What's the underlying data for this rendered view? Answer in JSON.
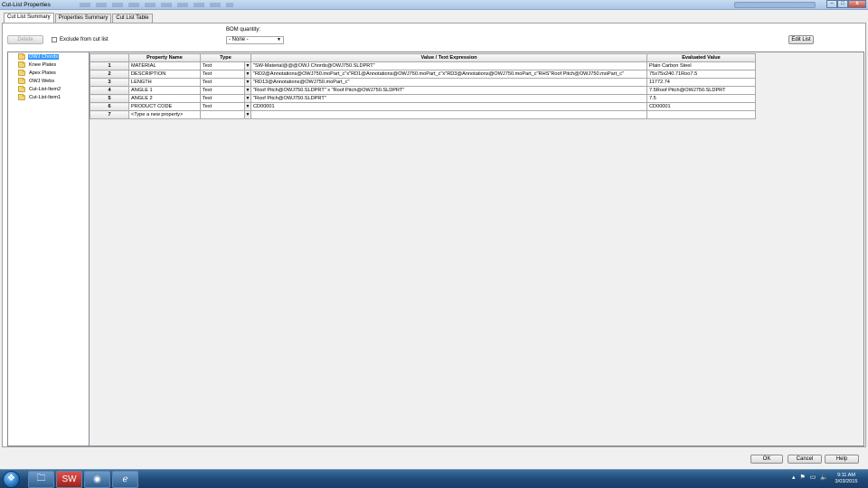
{
  "window": {
    "title": "Cut-List Properties",
    "close": "x",
    "maximize": "□",
    "minimize": "–"
  },
  "tabs": [
    {
      "label": "Cut List Summary",
      "active": true
    },
    {
      "label": "Properties Summary",
      "active": false
    },
    {
      "label": "Cut List Table",
      "active": false
    }
  ],
  "toolbar": {
    "delete_label": "Delete",
    "exclude_label": "Exclude from cut list",
    "bom_label": "BOM quantity:",
    "bom_value": "- None -",
    "edit_list_label": "Edit List"
  },
  "tree": {
    "items": [
      {
        "label": "OWJ Chords",
        "selected": true
      },
      {
        "label": "Knee Plates"
      },
      {
        "label": "Apex Plates"
      },
      {
        "label": "OWJ Webs"
      },
      {
        "label": "Cut-List-Item2"
      },
      {
        "label": "Cut-List-Item1"
      }
    ]
  },
  "grid": {
    "headers": [
      "",
      "Property Name",
      "Type",
      "Value / Text Expression",
      "Evaluated Value"
    ],
    "rows": [
      {
        "num": "1",
        "name": "MATERIAL",
        "type": "Text",
        "value": "\"SW-Material@@@OWJ Chords@OWJ750.SLDPRT\"",
        "evaluated": "Plain Carbon Steel"
      },
      {
        "num": "2",
        "name": "DESCRIPTION",
        "type": "Text",
        "value": "\"RD2@Annotations@OWJ750.moPart_c\"x\"RD1@Annotations@OWJ750.moPart_c\"x\"RD3@Annotations@OWJ750.moPart_c\"RHS\"Roof Pitch@OWJ750.moPart_c\"",
        "evaluated": "75x75x240.71Roo7.5"
      },
      {
        "num": "3",
        "name": "LENGTH",
        "type": "Text",
        "value": "\"RD13@Annotations@OWJ750.moPart_c\"",
        "evaluated": "11772.74"
      },
      {
        "num": "4",
        "name": "ANGLE 1",
        "type": "Text",
        "value": "\"Roof Pitch@OWJ750.SLDPRT\" x \"Roof Pitch@OWJ750.SLDPRT\"",
        "evaluated": "7.5Roof Pitch@OWJ750.SLDPRT"
      },
      {
        "num": "5",
        "name": "ANGLE 2",
        "type": "Text",
        "value": "\"Roof Pitch@OWJ750.SLDPRT\"",
        "evaluated": "7.5"
      },
      {
        "num": "6",
        "name": "PRODUCT CODE",
        "type": "Text",
        "value": "CD00001",
        "evaluated": "CD00001"
      },
      {
        "num": "7",
        "name": "<Type a new property>",
        "type": "",
        "value": "",
        "evaluated": ""
      }
    ]
  },
  "footer": {
    "ok_label": "OK",
    "cancel_label": "Cancel",
    "help_label": "Help"
  },
  "taskbar": {
    "time": "9:11 AM",
    "date": "3/03/2015"
  },
  "icons": {
    "folder": "folder-icon",
    "dropdown": "chevron-down-icon"
  },
  "colors": {
    "selection": "#3399ff",
    "taskbar": "#1f4b79"
  }
}
